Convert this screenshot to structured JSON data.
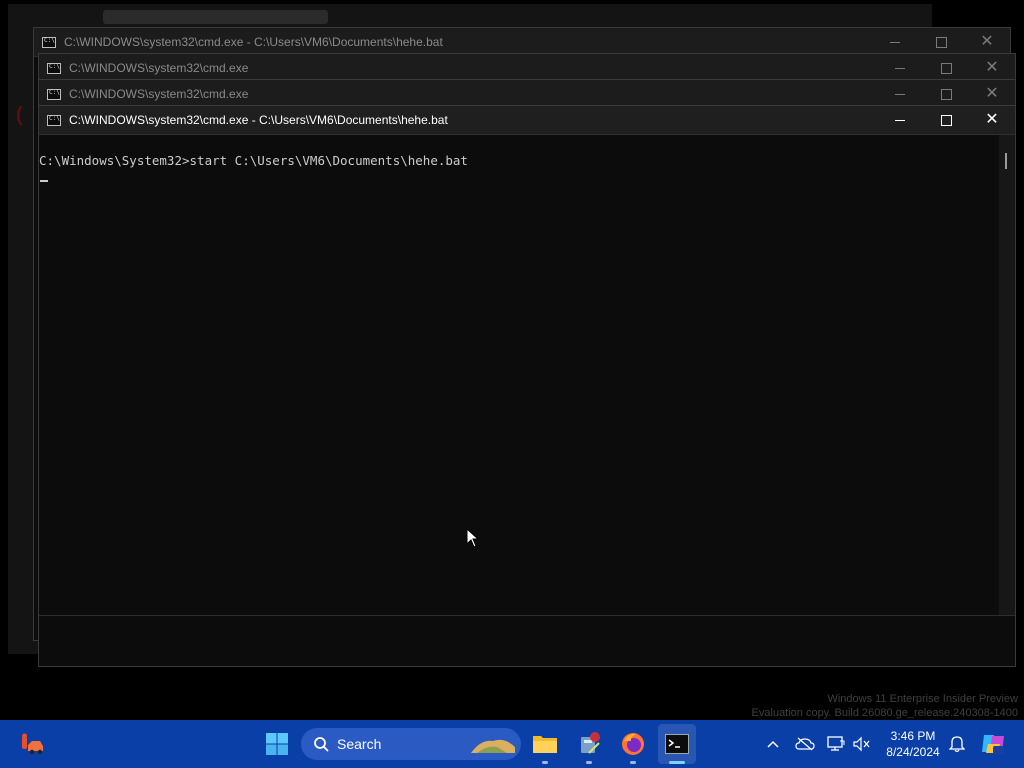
{
  "windows": [
    {
      "title": "C:\\WINDOWS\\system32\\cmd.exe - C:\\Users\\VM6\\Documents\\hehe.bat"
    },
    {
      "title": "C:\\WINDOWS\\system32\\cmd.exe"
    },
    {
      "title": "C:\\WINDOWS\\system32\\cmd.exe"
    },
    {
      "title": "C:\\WINDOWS\\system32\\cmd.exe - C:\\Users\\VM6\\Documents\\hehe.bat"
    }
  ],
  "console": {
    "command_line": "C:\\Windows\\System32>start C:\\Users\\VM6\\Documents\\hehe.bat"
  },
  "watermark": {
    "line1": "Windows 11 Enterprise Insider Preview",
    "line2": "Evaluation copy. Build 26080.ge_release.240308-1400"
  },
  "taskbar": {
    "search_label": "Search",
    "time": "3:46 PM",
    "date": "8/24/2024",
    "accent": "#0b3fa8"
  },
  "icons": [
    "start-icon",
    "search-icon",
    "file-explorer-icon",
    "app-icon",
    "firefox-icon",
    "terminal-icon",
    "chevron-up-icon",
    "cloud-offline-icon",
    "monitor-icon",
    "volume-muted-icon",
    "bell-icon",
    "copilot-icon",
    "widgets-icon"
  ]
}
